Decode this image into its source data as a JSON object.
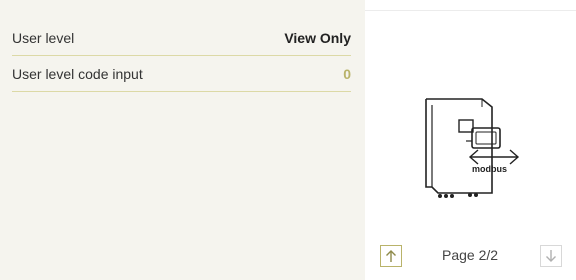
{
  "settings": {
    "rows": [
      {
        "label": "User level",
        "value": "View Only"
      },
      {
        "label": "User level code input",
        "value": "0"
      }
    ]
  },
  "illustration": {
    "icon": "modbus-device-icon",
    "caption": "modbus"
  },
  "pagination": {
    "page_label": "Page 2/2",
    "up_icon": "arrow-up-icon",
    "down_icon": "arrow-down-icon"
  },
  "colors": {
    "panel_bg": "#f5f4ee",
    "divider": "#dcd9a6",
    "value_text": "#222222",
    "value_accent": "#b9b36a",
    "button_border": "#cfcd9a"
  }
}
